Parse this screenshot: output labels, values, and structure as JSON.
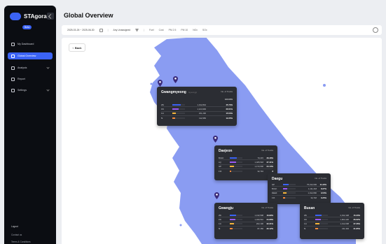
{
  "app": {
    "name": "STAgora",
    "badge": "Beta"
  },
  "sidebar": {
    "items": [
      {
        "label": "My Dashboard",
        "icon": "home-icon"
      },
      {
        "label": "Global Overview",
        "icon": "globe-icon",
        "active": true
      },
      {
        "label": "Analysis",
        "icon": "chart-icon"
      },
      {
        "label": "Report",
        "icon": "document-icon"
      },
      {
        "label": "Settings",
        "icon": "gear-icon"
      }
    ],
    "footer": {
      "logout": "Logout",
      "line1": "Contact us",
      "line2": "Terms & Conditions"
    }
  },
  "header": {
    "title": "Global Overview"
  },
  "toolbar": {
    "date_range": "2025-03-26 ~ 2025-06-30",
    "filter": "Any Unassigned",
    "chips": [
      "Fuel",
      "Cost",
      "PM 2.5",
      "PM 10",
      "NOx",
      "SOx"
    ]
  },
  "main": {
    "back_label": "Back"
  },
  "accent": "#3b63f5",
  "map_color": "#8a9cf2",
  "cards": [
    {
      "key": "c1",
      "title": "Gwangmyeong",
      "sub": "Gyeonggi",
      "head": "No. of Trucks",
      "rows": [
        {
          "label": "25t",
          "value": "1,312,844",
          "pct": "45.73%",
          "fill": 0.65,
          "color": "#3b63f5"
        },
        {
          "label": "15t",
          "value": "1,124,993",
          "pct": "26.51%",
          "fill": 0.5,
          "color": "#9b59f5"
        },
        {
          "label": "11t",
          "value": "231,200",
          "pct": "15.53%",
          "fill": 0.3,
          "color": "#f5b53b"
        },
        {
          "label": "5t",
          "value": "112,950",
          "pct": "12.25%",
          "fill": 0.2,
          "color": "#f58a3b"
        }
      ],
      "total": "100.00%"
    },
    {
      "key": "c2",
      "title": "Daejeon",
      "sub": "",
      "head": "No. of Trucks",
      "rows": [
        {
          "label": "BULK",
          "value": "70,215",
          "pct": "28.48%",
          "fill": 0.55,
          "color": "#3b63f5"
        },
        {
          "label": "LQ",
          "value": "1,025,518",
          "pct": "27.41%",
          "fill": 0.5,
          "color": "#9b59f5"
        },
        {
          "label": "GP",
          "value": "1,172,000",
          "pct": "24.13%",
          "fill": 0.35,
          "color": "#f5b53b"
        },
        {
          "label": "FIX",
          "value": "32,716",
          "pct": "8",
          "fill": 0.1,
          "color": "#f58a3b"
        }
      ]
    },
    {
      "key": "c3",
      "title": "Daegu",
      "sub": "",
      "head": "No. of Trucks",
      "rows": [
        {
          "label": "GP",
          "value": "75,312,000",
          "pct": "11.22%",
          "fill": 0.45,
          "color": "#3b63f5"
        },
        {
          "label": "BULK",
          "value": "1,111,218",
          "pct": "8.27%",
          "fill": 0.35,
          "color": "#9b59f5"
        },
        {
          "label": "REEF",
          "value": "1,012,800",
          "pct": "9.50%",
          "fill": 0.3,
          "color": "#f5b53b"
        },
        {
          "label": "FIX",
          "value": "34,718",
          "pct": "6.25%",
          "fill": 0.15,
          "color": "#f58a3b"
        }
      ]
    },
    {
      "key": "c4",
      "title": "Gwangju",
      "sub": "",
      "head": "No. of Trucks",
      "rows": [
        {
          "label": "25t",
          "value": "1,132,508",
          "pct": "16.89%",
          "fill": 0.5,
          "color": "#3b63f5"
        },
        {
          "label": "15t",
          "value": "1,040,510",
          "pct": "24.68%",
          "fill": 0.45,
          "color": "#9b59f5"
        },
        {
          "label": "11t",
          "value": "202,100",
          "pct": "22.31%",
          "fill": 0.35,
          "color": "#f5b53b"
        },
        {
          "label": "5t",
          "value": "87,150",
          "pct": "30.12%",
          "fill": 0.2,
          "color": "#f58a3b"
        }
      ]
    },
    {
      "key": "c5",
      "title": "Busan",
      "sub": "",
      "head": "No. of Trucks",
      "rows": [
        {
          "label": "25t",
          "value": "2,012,148",
          "pct": "15.33%",
          "fill": 0.5,
          "color": "#3b63f5"
        },
        {
          "label": "15t",
          "value": "1,824,120",
          "pct": "26.62%",
          "fill": 0.45,
          "color": "#9b59f5"
        },
        {
          "label": "11t",
          "value": "1,412,008",
          "pct": "27.26%",
          "fill": 0.35,
          "color": "#f5b53b"
        },
        {
          "label": "5t",
          "value": "211,302",
          "pct": "21.85%",
          "fill": 0.2,
          "color": "#f58a3b"
        }
      ]
    }
  ]
}
